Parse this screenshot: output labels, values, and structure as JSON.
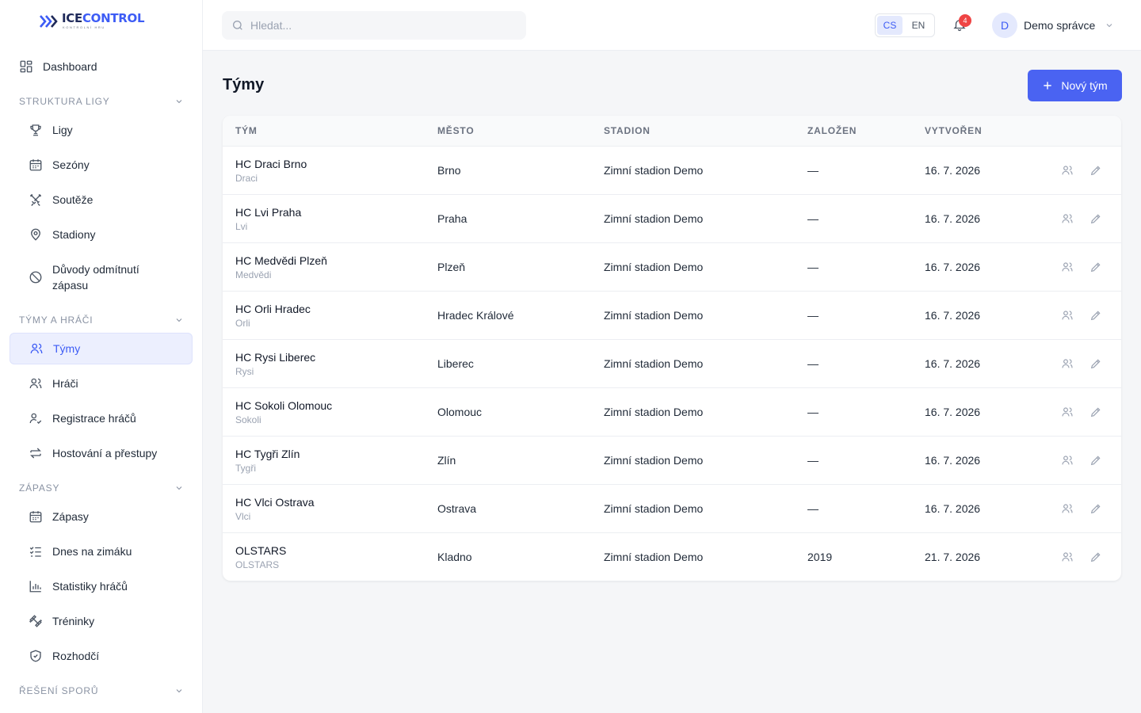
{
  "brand": {
    "name_part1": "ICE",
    "name_part2": "CONTROL",
    "tagline": "KONTROLNÍ HRU",
    "accent": "#3d5cf5"
  },
  "sidebar": {
    "top_items": [
      {
        "label": "Dashboard",
        "icon": "dashboard-icon"
      }
    ],
    "sections": [
      {
        "title": "STRUKTURA LIGY",
        "items": [
          {
            "label": "Ligy",
            "icon": "trophy-icon"
          },
          {
            "label": "Sezóny",
            "icon": "calendar-icon"
          },
          {
            "label": "Soutěže",
            "icon": "swords-icon"
          },
          {
            "label": "Stadiony",
            "icon": "map-pin-icon"
          },
          {
            "label": "Důvody odmítnutí zápasu",
            "icon": "ban-icon"
          }
        ]
      },
      {
        "title": "TÝMY A HRÁČI",
        "items": [
          {
            "label": "Týmy",
            "icon": "users-icon",
            "active": true
          },
          {
            "label": "Hráči",
            "icon": "users-icon"
          },
          {
            "label": "Registrace hráčů",
            "icon": "user-check-icon"
          },
          {
            "label": "Hostování a přestupy",
            "icon": "transfer-icon"
          }
        ]
      },
      {
        "title": "ZÁPASY",
        "items": [
          {
            "label": "Zápasy",
            "icon": "calendar-icon"
          },
          {
            "label": "Dnes na zimáku",
            "icon": "list-checks-icon"
          },
          {
            "label": "Statistiky hráčů",
            "icon": "bar-chart-icon"
          },
          {
            "label": "Tréninky",
            "icon": "dumbbell-icon"
          },
          {
            "label": "Rozhodčí",
            "icon": "shield-check-icon"
          }
        ]
      },
      {
        "title": "ŘEŠENÍ SPORŮ",
        "items": []
      }
    ]
  },
  "topbar": {
    "search_placeholder": "Hledat...",
    "languages": [
      {
        "code": "CS",
        "selected": true
      },
      {
        "code": "EN",
        "selected": false
      }
    ],
    "notifications_count": "4",
    "user": {
      "initial": "D",
      "name": "Demo správce"
    }
  },
  "page": {
    "title": "Týmy",
    "new_button_label": "Nový tým",
    "columns": [
      "TÝM",
      "MĚSTO",
      "STADION",
      "ZALOŽEN",
      "VYTVOŘEN"
    ],
    "rows": [
      {
        "name": "HC Draci Brno",
        "short": "Draci",
        "city": "Brno",
        "stadium": "Zimní stadion Demo",
        "founded": "—",
        "created": "16. 7. 2026"
      },
      {
        "name": "HC Lvi Praha",
        "short": "Lvi",
        "city": "Praha",
        "stadium": "Zimní stadion Demo",
        "founded": "—",
        "created": "16. 7. 2026"
      },
      {
        "name": "HC Medvědi Plzeň",
        "short": "Medvědi",
        "city": "Plzeň",
        "stadium": "Zimní stadion Demo",
        "founded": "—",
        "created": "16. 7. 2026"
      },
      {
        "name": "HC Orli Hradec",
        "short": "Orli",
        "city": "Hradec Králové",
        "stadium": "Zimní stadion Demo",
        "founded": "—",
        "created": "16. 7. 2026"
      },
      {
        "name": "HC Rysi Liberec",
        "short": "Rysi",
        "city": "Liberec",
        "stadium": "Zimní stadion Demo",
        "founded": "—",
        "created": "16. 7. 2026"
      },
      {
        "name": "HC Sokoli Olomouc",
        "short": "Sokoli",
        "city": "Olomouc",
        "stadium": "Zimní stadion Demo",
        "founded": "—",
        "created": "16. 7. 2026"
      },
      {
        "name": "HC Tygři Zlín",
        "short": "Tygři",
        "city": "Zlín",
        "stadium": "Zimní stadion Demo",
        "founded": "—",
        "created": "16. 7. 2026"
      },
      {
        "name": "HC Vlci Ostrava",
        "short": "Vlci",
        "city": "Ostrava",
        "stadium": "Zimní stadion Demo",
        "founded": "—",
        "created": "16. 7. 2026"
      },
      {
        "name": "OLSTARS",
        "short": "OLSTARS",
        "city": "Kladno",
        "stadium": "Zimní stadion Demo",
        "founded": "2019",
        "created": "21. 7. 2026"
      }
    ]
  }
}
